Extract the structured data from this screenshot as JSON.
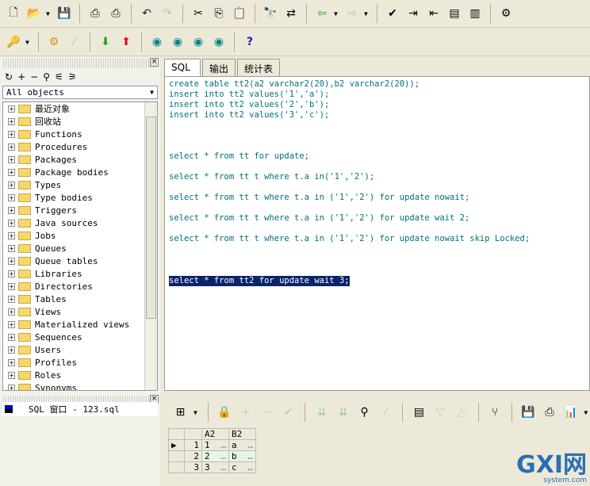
{
  "toolbar1": [
    "new-icon",
    "open-icon",
    "save-icon",
    "print-icon",
    "print-preview-icon",
    "undo-icon",
    "redo-icon",
    "cut-icon",
    "copy-icon",
    "paste-icon",
    "find-icon",
    "replace-icon",
    "back-icon",
    "forward-icon",
    "execute-icon",
    "indent-icon",
    "unindent-icon",
    "comment-icon",
    "uncomment-icon",
    "options-icon"
  ],
  "toolbar2": [
    "key-icon",
    "settings-icon",
    "disabled-icon",
    "import-icon",
    "export-icon",
    "explain-icon",
    "sql-icon",
    "search-db-icon",
    "disconnect-icon",
    "help-icon"
  ],
  "left": {
    "filter": "All objects",
    "tree": [
      "最近对象",
      "回收站",
      "Functions",
      "Procedures",
      "Packages",
      "Package bodies",
      "Types",
      "Type bodies",
      "Triggers",
      "Java sources",
      "Jobs",
      "Queues",
      "Queue tables",
      "Libraries",
      "Directories",
      "Tables",
      "Views",
      "Materialized views",
      "Sequences",
      "Users",
      "Profiles",
      "Roles",
      "Synonyms"
    ],
    "window": "SQL 窗口 - 123.sql"
  },
  "tabs": [
    "SQL",
    "输出",
    "统计表"
  ],
  "editor": {
    "lines": [
      "create table tt2(a2 varchar2(20),b2 varchar2(20));",
      "insert into tt2 values('1','a');",
      "insert into tt2 values('2','b');",
      "insert into tt2 values('3','c');",
      "",
      "",
      "",
      "select * from tt for update;",
      "",
      "select * from tt t where t.a in('1','2');",
      "",
      "select * from tt t where t.a in ('1','2') for update nowait;",
      "",
      "select * from tt t where t.a in ('1','2') for update wait 2;",
      "",
      "select * from tt t where t.a in ('1','2') for update nowait skip Locked;",
      "",
      "",
      ""
    ],
    "selected": "select * from tt2 for update wait 3;"
  },
  "grid": {
    "columns": [
      "A2",
      "B2"
    ],
    "rows": [
      [
        "1",
        "1",
        "a"
      ],
      [
        "2",
        "2",
        "b"
      ],
      [
        "3",
        "3",
        "c"
      ]
    ],
    "ellipsis": "…"
  },
  "watermark": {
    "text": "GXI网",
    "sub": "system.com"
  }
}
